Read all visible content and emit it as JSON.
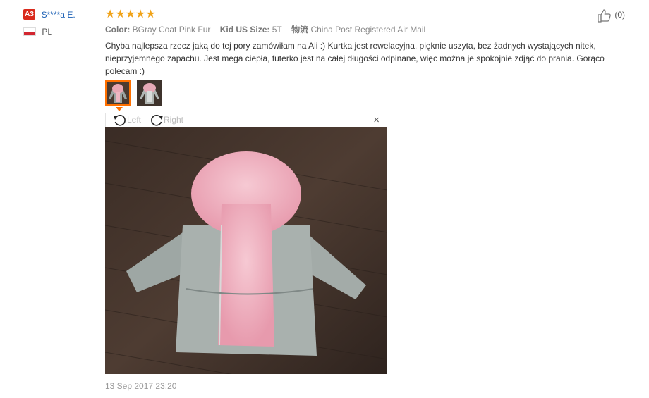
{
  "buyer": {
    "level_badge": "A3",
    "name": "S****a E.",
    "country_code": "PL"
  },
  "review": {
    "rating": 5,
    "stars": "★★★★★",
    "attributes": [
      {
        "key": "Color:",
        "value": "BGray Coat Pink Fur"
      },
      {
        "key": "Kid US Size:",
        "value": "5T"
      },
      {
        "key": "物流",
        "value": "China Post Registered Air Mail"
      }
    ],
    "text": "Chyba najlepsza rzecz jaką do tej pory zamówiłam na Ali :) Kurtka jest rewelacyjna, pięknie uszyta, bez żadnych wystających nitek, nieprzyjemnego zapachu. Jest mega ciepła, futerko jest na całej długości odpinane, więc można je spokojnie zdjąć do prania. Gorąco polecam :)",
    "helpful_count": "(0)",
    "date": "13 Sep 2017 23:20"
  },
  "viewer": {
    "rotate_left_label": "Left",
    "rotate_right_label": "Right",
    "close_symbol": "×"
  },
  "colors": {
    "badge": "#d92a1c",
    "buyer_link": "#1a5fb4",
    "star": "#f0a217",
    "thumb_active": "#ff7000"
  }
}
